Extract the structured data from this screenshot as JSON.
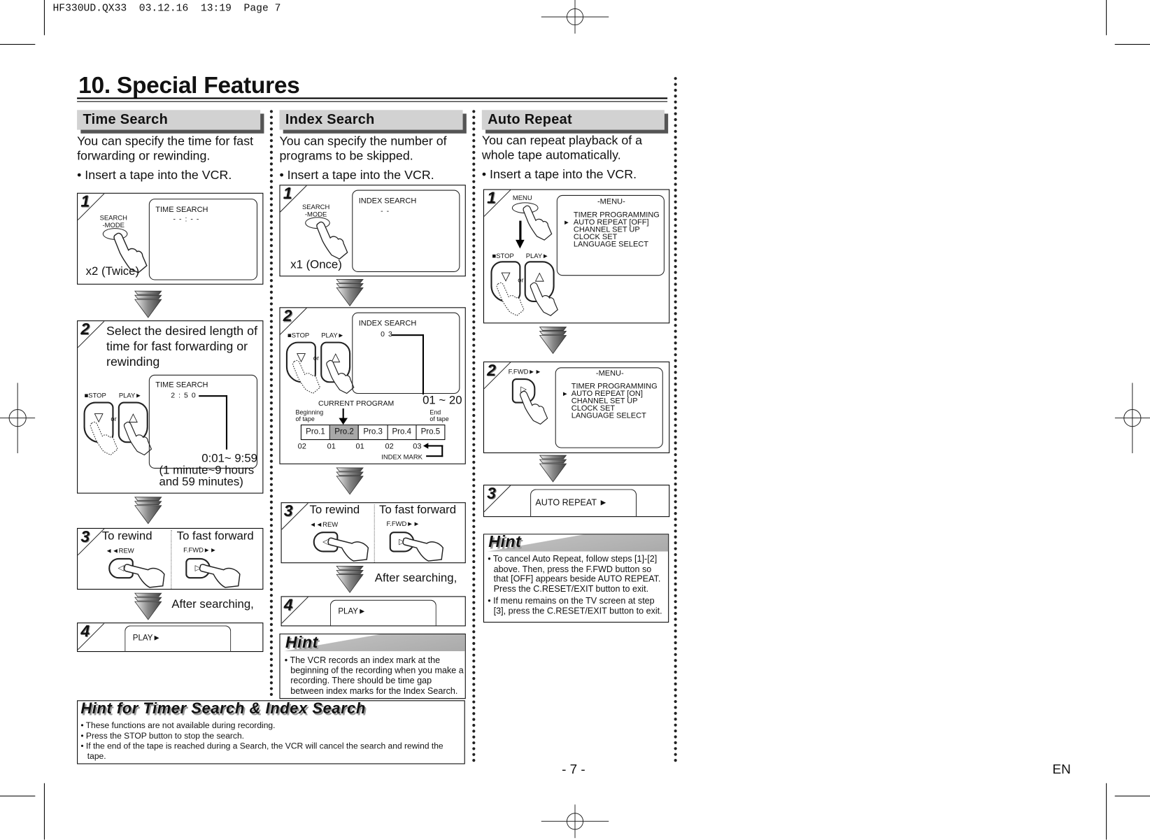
{
  "print_header": "HF330UD.QX33  03.12.16  13:19  Page 7",
  "title": "10. Special Features",
  "time_search": {
    "heading": "Time Search",
    "intro": "You can specify the time for fast forwarding or rewinding.",
    "bullet": "• Insert a tape into the VCR.",
    "step1": {
      "num": "1",
      "button_label_1": "SEARCH",
      "button_label_2": "-MODE",
      "screen_title": "TIME SEARCH",
      "screen_value": "- - : - -",
      "caption": "x2 (Twice)"
    },
    "step2": {
      "num": "2",
      "text": "Select the desired length of time for fast forwarding or rewinding",
      "stop_label": "■STOP",
      "play_label": "PLAY►",
      "or": "or",
      "screen_title": "TIME SEARCH",
      "screen_value": "2 : 5 0",
      "range": "0:01~ 9:59",
      "range_note_1": "(1 minute~9 hours",
      "range_note_2": "and 59 minutes)"
    },
    "step3": {
      "num": "3",
      "rewind": "To rewind",
      "fast_forward": "To fast forward",
      "rew_label": "◄◄REW",
      "ffwd_label": "F.FWD►►"
    },
    "after": "After searching,",
    "step4": {
      "num": "4",
      "screen_text": "PLAY►"
    }
  },
  "index_search": {
    "heading": "Index Search",
    "intro": "You can specify the number of programs to be skipped.",
    "bullet": "• Insert a tape into the VCR.",
    "step1": {
      "num": "1",
      "button_label_1": "SEARCH",
      "button_label_2": "-MODE",
      "screen_title": "INDEX SEARCH",
      "screen_value": "- -",
      "caption": "x1 (Once)"
    },
    "step2": {
      "num": "2",
      "stop_label": "■STOP",
      "play_label": "PLAY►",
      "or": "or",
      "screen_title": "INDEX SEARCH",
      "screen_value": "0 3",
      "range": "01 ~ 20",
      "current_program": "CURRENT PROGRAM",
      "beginning_1": "Beginning",
      "beginning_2": "of tape",
      "end_1": "End",
      "end_2": "of tape",
      "programs": [
        "Pro.1",
        "Pro.2",
        "Pro.3",
        "Pro.4",
        "Pro.5"
      ],
      "current_index": 1,
      "index_numbers": [
        "02",
        "01",
        "01",
        "02",
        "03"
      ],
      "index_mark": "INDEX MARK"
    },
    "step3": {
      "num": "3",
      "rewind": "To rewind",
      "fast_forward": "To fast forward",
      "rew_label": "◄◄REW",
      "ffwd_label": "F.FWD►►"
    },
    "after": "After searching,",
    "step4": {
      "num": "4",
      "screen_text": "PLAY►"
    },
    "hint": {
      "title": "Hint",
      "items": [
        "• The VCR records an index mark at the beginning of the recording when you make a recording. There should be time gap between index marks for the Index Search."
      ]
    }
  },
  "auto_repeat": {
    "heading": "Auto Repeat",
    "intro": "You can repeat playback of a whole tape automatically.",
    "bullet": "• Insert a tape into the VCR.",
    "step1": {
      "num": "1",
      "menu_label": "MENU",
      "stop_label": "■STOP",
      "play_label": "PLAY►",
      "or": "or",
      "menu_title": "-MENU-",
      "menu_items": [
        "TIMER PROGRAMMING",
        "AUTO REPEAT  [OFF]",
        "CHANNEL SET UP",
        "CLOCK SET",
        "LANGUAGE SELECT"
      ],
      "pointer": "►"
    },
    "step2": {
      "num": "2",
      "ffwd_label": "F.FWD►►",
      "menu_title": "-MENU-",
      "menu_items": [
        "TIMER PROGRAMMING",
        "AUTO REPEAT  [ON]",
        "CHANNEL SET UP",
        "CLOCK SET",
        "LANGUAGE SELECT"
      ],
      "pointer": "►"
    },
    "step3": {
      "num": "3",
      "screen_text": "AUTO REPEAT ►"
    },
    "hint": {
      "title": "Hint",
      "items": [
        "• To cancel Auto Repeat, follow steps [1]-[2] above.  Then, press the F.FWD button so that [OFF] appears beside AUTO REPEAT. Press the C.RESET/EXIT button to exit.",
        "• If menu remains on the TV screen at step [3], press the C.RESET/EXIT button to exit."
      ]
    }
  },
  "shared_hint": {
    "title": "Hint for Timer Search & Index Search",
    "items": [
      "• These functions are not available during recording.",
      "• Press the STOP button to stop the search.",
      "• If the end of the tape is reached during a Search, the VCR will cancel the search and rewind the tape."
    ]
  },
  "page_number": "- 7 -",
  "language": "EN"
}
